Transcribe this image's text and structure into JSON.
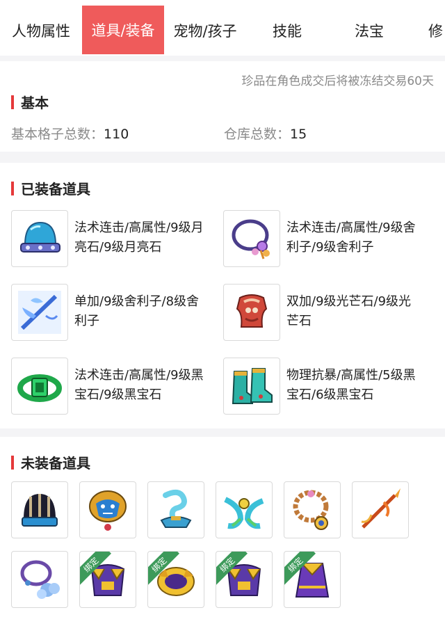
{
  "tabs": [
    {
      "label": "人物属性",
      "active": false
    },
    {
      "label": "道具/装备",
      "active": true
    },
    {
      "label": "宠物/孩子",
      "active": false
    },
    {
      "label": "技能",
      "active": false
    },
    {
      "label": "法宝",
      "active": false
    },
    {
      "label": "修",
      "active": false
    }
  ],
  "basic": {
    "notice": "珍品在角色成交后将被冻结交易60天",
    "title": "基本",
    "slots_label": "基本格子总数：",
    "slots_value": "110",
    "storage_label": "仓库总数：",
    "storage_value": "15"
  },
  "equipped": {
    "title": "已装备道具",
    "items": [
      {
        "icon": "helmet-icon",
        "line1": "法术连击/高属性/9级月",
        "line2": "亮石/9级月亮石"
      },
      {
        "icon": "necklace-icon",
        "line1": "法术连击/高属性/9级舍",
        "line2": "利子/9级舍利子"
      },
      {
        "icon": "weapon-icon",
        "line1": "单加/9级舍利子/8级舍",
        "line2": "利子"
      },
      {
        "icon": "armor-icon",
        "line1": "双加/9级光芒石/9级光",
        "line2": "芒石"
      },
      {
        "icon": "belt-icon",
        "line1": "法术连击/高属性/9级黑",
        "line2": "宝石/9级黑宝石"
      },
      {
        "icon": "boots-icon",
        "line1": "物理抗暴/高属性/5级黑",
        "line2": "宝石/6级黑宝石"
      }
    ]
  },
  "unequipped": {
    "title": "未装备道具",
    "bound_label": "绑定",
    "items": [
      {
        "icon": "hat-icon",
        "bound": false
      },
      {
        "icon": "demon-amulet-icon",
        "bound": false
      },
      {
        "icon": "lamp-icon",
        "bound": false
      },
      {
        "icon": "ribbon-icon",
        "bound": false
      },
      {
        "icon": "bead-necklace-icon",
        "bound": false
      },
      {
        "icon": "spear-icon",
        "bound": false
      },
      {
        "icon": "cloud-necklace-icon",
        "bound": false
      },
      {
        "icon": "gold-armor-icon",
        "bound": true
      },
      {
        "icon": "gold-ring-icon",
        "bound": true
      },
      {
        "icon": "gold-armor-icon",
        "bound": true
      },
      {
        "icon": "purple-robe-icon",
        "bound": true
      }
    ]
  },
  "colors": {
    "accent": "#ef5b5b",
    "section_bar": "#e5393a",
    "bound_badge": "#3d9a5a",
    "muted_text": "#8a8a8a"
  }
}
